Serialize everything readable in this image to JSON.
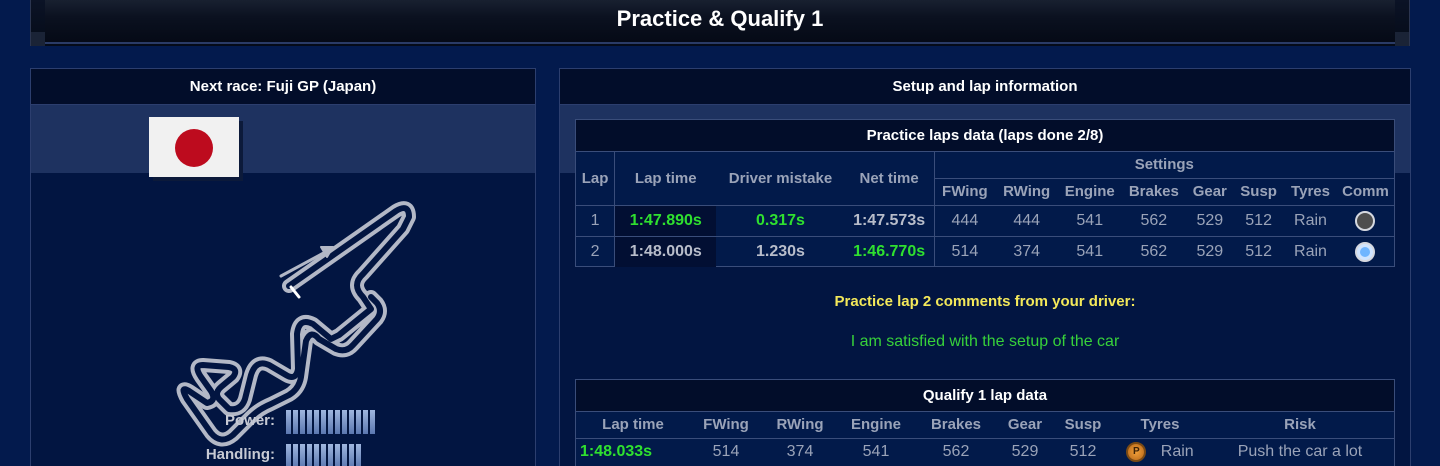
{
  "page": {
    "title": "Practice & Qualify 1"
  },
  "left": {
    "heading": "Next race: Fuji GP (Japan)",
    "flag_icon": "japan-flag",
    "stats": [
      {
        "label": "Power:",
        "bars": 13
      },
      {
        "label": "Handling:",
        "bars": 11
      }
    ]
  },
  "right": {
    "heading": "Setup and lap information",
    "practice": {
      "title": "Practice laps data (laps done 2/8)",
      "col_lap": "Lap",
      "col_lap_time": "Lap time",
      "col_driver_mistake": "Driver mistake",
      "col_net_time": "Net time",
      "col_settings": "Settings",
      "settings_cols": [
        "FWing",
        "RWing",
        "Engine",
        "Brakes",
        "Gear",
        "Susp",
        "Tyres",
        "Comm"
      ],
      "rows": [
        {
          "lap": "1",
          "lap_time": "1:47.890s",
          "mistake": "0.317s",
          "net": "1:47.573s",
          "fwing": "444",
          "rwing": "444",
          "engine": "541",
          "brakes": "562",
          "gear": "529",
          "susp": "512",
          "tyres": "Rain"
        },
        {
          "lap": "2",
          "lap_time": "1:48.000s",
          "mistake": "1.230s",
          "net": "1:46.770s",
          "fwing": "514",
          "rwing": "374",
          "engine": "541",
          "brakes": "562",
          "gear": "529",
          "susp": "512",
          "tyres": "Rain"
        }
      ]
    },
    "comment_title": "Practice lap 2 comments from your driver:",
    "comment_text": "I am satisfied with the setup of the car",
    "qualify": {
      "title": "Qualify 1 lap data",
      "cols": [
        "Lap time",
        "FWing",
        "RWing",
        "Engine",
        "Brakes",
        "Gear",
        "Susp",
        "Tyres",
        "Risk"
      ],
      "row": {
        "lap_time": "1:48.033s",
        "fwing": "514",
        "rwing": "374",
        "engine": "541",
        "brakes": "562",
        "gear": "529",
        "susp": "512",
        "tyre_badge": "P",
        "tyres": "Rain",
        "risk": "Push the car a lot"
      }
    }
  }
}
